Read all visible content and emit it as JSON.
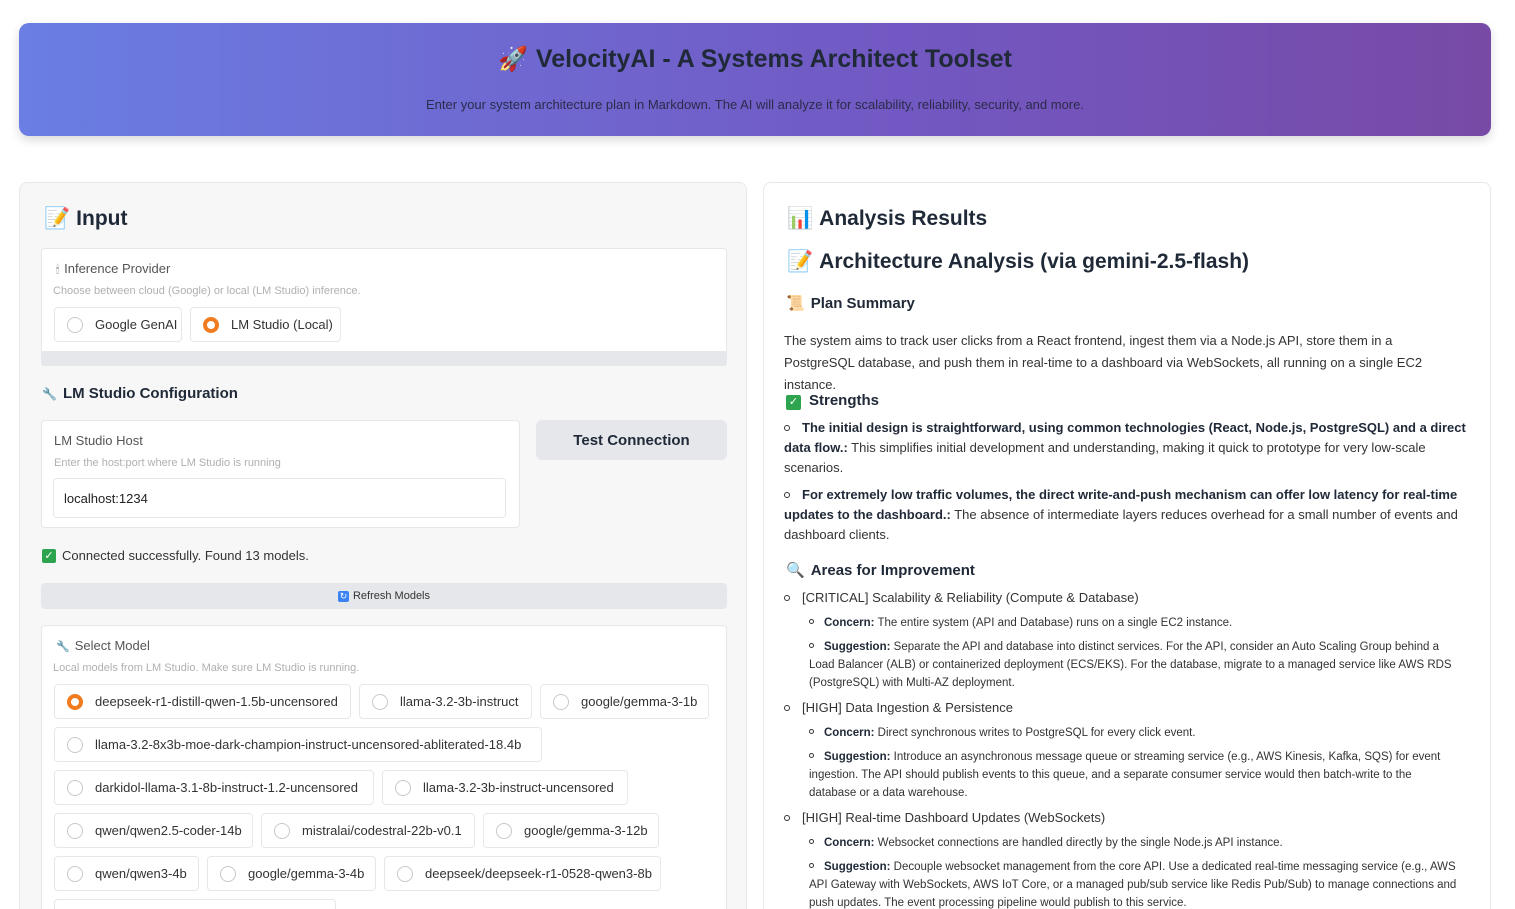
{
  "header": {
    "title": "VelocityAI - A Systems Architect Toolset",
    "subtitle": "Enter your system architecture plan in Markdown. The AI will analyze it for scalability, reliability, security, and more."
  },
  "input_panel": {
    "heading": "Input",
    "provider": {
      "label": "Inference Provider",
      "info": "Choose between cloud (Google) or local (LM Studio) inference.",
      "options": [
        "Google GenAI",
        "LM Studio (Local)"
      ],
      "selected": "LM Studio (Local)"
    },
    "lm_config": {
      "heading": "LM Studio Configuration",
      "host_label": "LM Studio Host",
      "host_info": "Enter the host:port where LM Studio is running",
      "host_value": "localhost:1234",
      "test_button": "Test Connection",
      "status": "Connected successfully. Found 13 models.",
      "refresh_button": "Refresh Models"
    },
    "model_select": {
      "label": "Select Model",
      "info": "Local models from LM Studio. Make sure LM Studio is running.",
      "options": [
        "deepseek-r1-distill-qwen-1.5b-uncensored",
        "llama-3.2-3b-instruct",
        "google/gemma-3-1b",
        "llama-3.2-8x3b-moe-dark-champion-instruct-uncensored-abliterated-18.4b",
        "darkidol-llama-3.1-8b-instruct-1.2-uncensored",
        "llama-3.2-3b-instruct-uncensored",
        "qwen/qwen2.5-coder-14b",
        "mistralai/codestral-22b-v0.1",
        "google/gemma-3-12b",
        "qwen/qwen3-4b",
        "google/gemma-3-4b",
        "deepseek/deepseek-r1-0528-qwen3-8b"
      ],
      "selected": "deepseek-r1-distill-qwen-1.5b-uncensored"
    }
  },
  "results_panel": {
    "heading": "Analysis Results",
    "analysis_title": "Architecture Analysis (via gemini-2.5-flash)",
    "plan_summary_heading": "Plan Summary",
    "plan_summary": "The system aims to track user clicks from a React frontend, ingest them via a Node.js API, store them in a PostgreSQL database, and push them in real-time to a dashboard via WebSockets, all running on a single EC2 instance.",
    "strengths_heading": "Strengths",
    "strengths": [
      {
        "bold": "The initial design is straightforward, using common technologies (React, Node.js, PostgreSQL) and a direct data flow.:",
        "text": " This simplifies initial development and understanding, making it quick to prototype for very low-scale scenarios."
      },
      {
        "bold": "For extremely low traffic volumes, the direct write-and-push mechanism can offer low latency for real-time updates to the dashboard.:",
        "text": " The absence of intermediate layers reduces overhead for a small number of events and dashboard clients."
      }
    ],
    "improvements_heading": "Areas for Improvement",
    "improvements": [
      {
        "title": "[CRITICAL] Scalability & Reliability (Compute & Database)",
        "concern_label": "Concern:",
        "concern": " The entire system (API and Database) runs on a single EC2 instance.",
        "suggestion_label": "Suggestion:",
        "suggestion": " Separate the API and database into distinct services. For the API, consider an Auto Scaling Group behind a Load Balancer (ALB) or containerized deployment (ECS/EKS). For the database, migrate to a managed service like AWS RDS (PostgreSQL) with Multi-AZ deployment."
      },
      {
        "title": "[HIGH] Data Ingestion & Persistence",
        "concern_label": "Concern:",
        "concern": " Direct synchronous writes to PostgreSQL for every click event.",
        "suggestion_label": "Suggestion:",
        "suggestion": " Introduce an asynchronous message queue or streaming service (e.g., AWS Kinesis, Kafka, SQS) for event ingestion. The API should publish events to this queue, and a separate consumer service would then batch-write to the database or a data warehouse."
      },
      {
        "title": "[HIGH] Real-time Dashboard Updates (WebSockets)",
        "concern_label": "Concern:",
        "concern": " Websocket connections are handled directly by the single Node.js API instance.",
        "suggestion_label": "Suggestion:",
        "suggestion": " Decouple websocket management from the core API. Use a dedicated real-time messaging service (e.g., AWS API Gateway with WebSockets, AWS IoT Core, or a managed pub/sub service like Redis Pub/Sub) to manage connections and push updates. The event processing pipeline would publish to this service."
      }
    ]
  },
  "colors": {
    "header_gradient_start": "#6a7ee3",
    "header_gradient_end": "#774aa6",
    "radio_accent": "#f17c20",
    "success": "#2ea44f"
  }
}
